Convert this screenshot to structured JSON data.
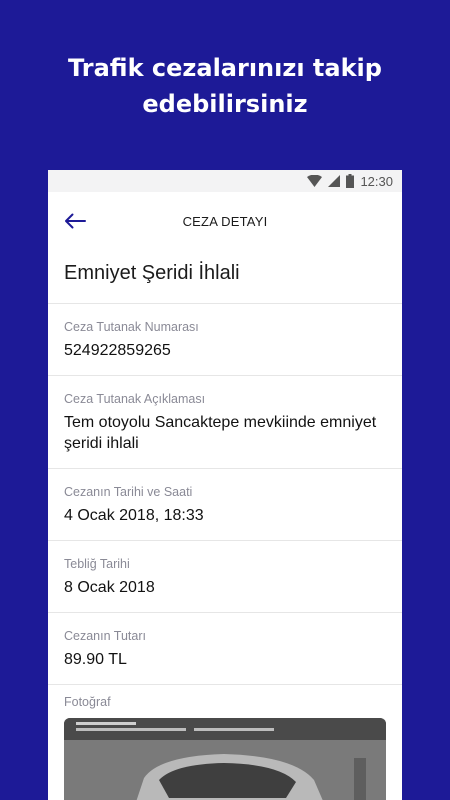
{
  "promo": {
    "line1": "Trafik cezalarınızı takip",
    "line2": "edebilirsiniz"
  },
  "status_bar": {
    "time": "12:30",
    "icons": [
      "wifi-icon",
      "signal-icon",
      "battery-icon"
    ]
  },
  "app_bar": {
    "title": "CEZA DETAYI",
    "back_icon": "arrow-left-icon"
  },
  "detail": {
    "title": "Emniyet Şeridi İhlali",
    "fields": [
      {
        "label": "Ceza Tutanak Numarası",
        "value": "524922859265"
      },
      {
        "label": "Ceza Tutanak Açıklaması",
        "value": "Tem otoyolu Sancaktepe mevkiinde emniyet şeridi ihlali"
      },
      {
        "label": "Cezanın Tarihi ve Saati",
        "value": "4 Ocak 2018, 18:33"
      },
      {
        "label": "Tebliğ Tarihi",
        "value": "8 Ocak 2018"
      },
      {
        "label": "Cezanın Tutarı",
        "value": "89.90 TL"
      }
    ],
    "photo_label": "Fotoğraf"
  },
  "colors": {
    "background": "#1d1a97",
    "accent": "#1d1a97"
  }
}
